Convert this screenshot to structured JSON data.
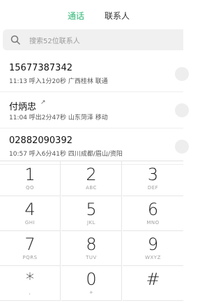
{
  "tabs": {
    "calls": "通话",
    "contacts": "联系人"
  },
  "search": {
    "placeholder": "搜索52位联系人"
  },
  "calls": [
    {
      "name": "15677387342",
      "meta": "11:13 呼入1分20秒  广西桂林 联通",
      "outgoing": false
    },
    {
      "name": "付炳忠",
      "meta": "11:04 呼出2分47秒  山东菏泽 移动",
      "outgoing": true
    },
    {
      "name": "02882090392",
      "meta": "10:57 呼入6分41秒  四川成都/眉山/资阳",
      "outgoing": false
    }
  ],
  "keypad": [
    {
      "digit": "1",
      "letters": "QO"
    },
    {
      "digit": "2",
      "letters": "ABC"
    },
    {
      "digit": "3",
      "letters": "DEF"
    },
    {
      "digit": "4",
      "letters": "GHI"
    },
    {
      "digit": "5",
      "letters": "JKL"
    },
    {
      "digit": "6",
      "letters": "MNO"
    },
    {
      "digit": "7",
      "letters": "PQRS"
    },
    {
      "digit": "8",
      "letters": "TUV"
    },
    {
      "digit": "9",
      "letters": "WXYZ"
    },
    {
      "digit": "*",
      "letters": ","
    },
    {
      "digit": "0",
      "letters": "+"
    },
    {
      "digit": "#",
      "letters": ""
    }
  ],
  "colors": {
    "accent": "#2bb673"
  }
}
